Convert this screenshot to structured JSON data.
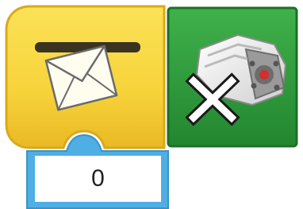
{
  "blocks": [
    {
      "name": "send-message-block",
      "icon": "envelope-icon",
      "color": "#f7d33a",
      "edge_color": "#e0ac1c",
      "input": {
        "value": "0",
        "frame_color": "#4faee3",
        "field_color": "#ffffff"
      }
    },
    {
      "name": "stop-motor-block",
      "icon": "motor-stop-icon",
      "color": "#2e9c3a",
      "edge_color": "#1f7a2a",
      "overlay_icon": "x-icon"
    }
  ]
}
